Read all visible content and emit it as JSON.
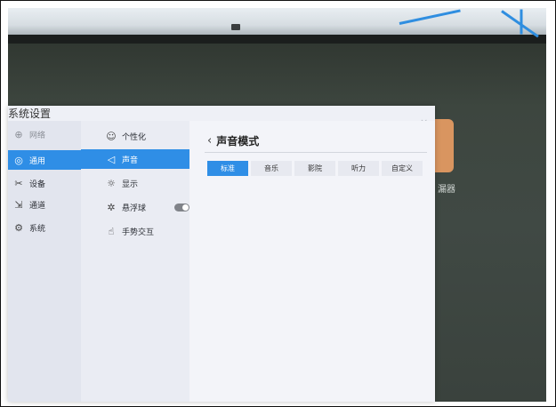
{
  "window": {
    "title": "系统设置",
    "close_glyph": "×"
  },
  "background": {
    "label": "漏器",
    "accent_color": "#2f8ee6"
  },
  "sidebar": {
    "items": [
      {
        "label": "网络",
        "icon": "globe-icon",
        "glyph": "⊕",
        "state": "faded"
      },
      {
        "label": "通用",
        "icon": "general-icon",
        "glyph": "◎",
        "state": "selected"
      },
      {
        "label": "设备",
        "icon": "tools-icon",
        "glyph": "✂",
        "state": "normal"
      },
      {
        "label": "通道",
        "icon": "input-channel-icon",
        "glyph": "⇲",
        "state": "normal"
      },
      {
        "label": "系统",
        "icon": "system-icon",
        "glyph": "⚙",
        "state": "normal"
      }
    ]
  },
  "subnav": {
    "items": [
      {
        "label": "个性化",
        "icon": "palette-icon",
        "glyph": "☺",
        "state": "normal"
      },
      {
        "label": "声音",
        "icon": "speaker-icon",
        "glyph": "◁",
        "state": "selected"
      },
      {
        "label": "显示",
        "icon": "brightness-icon",
        "glyph": "☼",
        "state": "normal"
      },
      {
        "label": "悬浮球",
        "icon": "floating-ball-icon",
        "glyph": "✲",
        "state": "normal",
        "toggle_on": false
      },
      {
        "label": "手势交互",
        "icon": "gesture-icon",
        "glyph": "☝",
        "state": "normal"
      }
    ]
  },
  "content": {
    "back_glyph": "‹",
    "title": "声音模式",
    "modes": [
      {
        "label": "标准",
        "active": true
      },
      {
        "label": "音乐",
        "active": false
      },
      {
        "label": "影院",
        "active": false
      },
      {
        "label": "听力",
        "active": false
      },
      {
        "label": "自定义",
        "active": false
      }
    ]
  }
}
